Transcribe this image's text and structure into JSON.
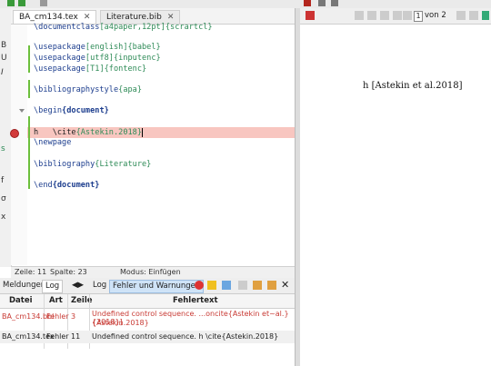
{
  "sidebar": {
    "chars": [
      "B",
      "U",
      "I",
      "s",
      "f",
      "σ",
      "x"
    ]
  },
  "tabs": [
    {
      "label": "BA_cm134.tex",
      "close": "✕"
    },
    {
      "label": "Literature.bib",
      "close": "✕"
    }
  ],
  "editor": {
    "lines": [
      {
        "cmd": "\\documentclass",
        "arg": "[a4paper,12pt]{scrartcl}"
      },
      {
        "cmd": "",
        "arg": ""
      },
      {
        "cmd": "\\usepackage",
        "arg": "[english]{babel}"
      },
      {
        "cmd": "\\usepackage",
        "arg": "[utf8]{inputenc}"
      },
      {
        "cmd": "\\usepackage",
        "arg": "[T1]{fontenc}"
      },
      {
        "cmd": "",
        "arg": ""
      },
      {
        "cmd": "\\bibliographystyle",
        "arg": "{apa}"
      },
      {
        "cmd": "",
        "arg": ""
      },
      {
        "cmd": "\\begin",
        "arg": "{document}"
      },
      {
        "cmd": "",
        "arg": ""
      },
      {
        "cmd": "h   \\cite",
        "arg": "{Astekin.2018}"
      },
      {
        "cmd": "\\newpage",
        "arg": ""
      },
      {
        "cmd": "",
        "arg": ""
      },
      {
        "cmd": "\\bibliography",
        "arg": "{Literature}"
      },
      {
        "cmd": "",
        "arg": ""
      },
      {
        "cmd": "\\end",
        "arg": "{document}"
      }
    ]
  },
  "status": {
    "line": "Zeile: 11",
    "column": "Spalte: 23",
    "mode": "Modus: Einfügen"
  },
  "viewer": {
    "page": "1",
    "of": "von 2",
    "content": "h [Astekin et al.2018]"
  },
  "log": {
    "tabs": {
      "messages": "Meldungen",
      "log": "Log",
      "log2": "Log",
      "errors_warnings": "Fehler und Warnungen"
    },
    "headers": {
      "file": "Datei",
      "type": "Art",
      "line": "Zeile",
      "text": "Fehlertext"
    },
    "rows": [
      {
        "file": "BA_cm134.bbl",
        "type": "Fehler",
        "line": "3",
        "text1": "Undefined control sequence. ...oncite{Astekin et~al.}{2018}]",
        "text2": "{Astekin.2018}"
      },
      {
        "file": "BA_cm134.tex",
        "type": "Fehler",
        "line": "11",
        "text1": "Undefined control sequence. h \\cite{Astekin.2018}",
        "text2": ""
      }
    ]
  },
  "colors": {
    "error": "#c83a34",
    "highlight": "#f8c6c0",
    "accent": "#1d3e8e"
  }
}
